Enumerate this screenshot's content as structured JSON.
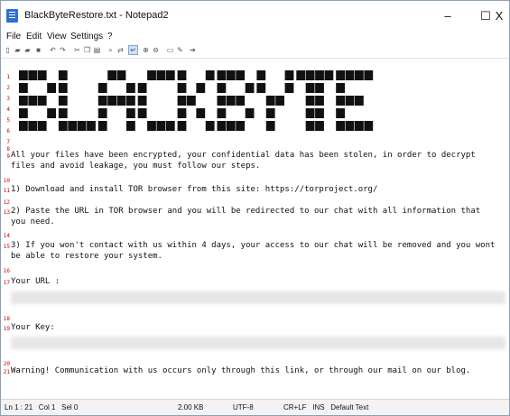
{
  "window": {
    "title": "BlackByteRestore.txt - Notepad2",
    "minimize": "–",
    "maximize": "☐",
    "close": "X"
  },
  "menu": [
    "File",
    "Edit",
    "View",
    "Settings",
    "?"
  ],
  "toolbar_icons": [
    "new-file-icon",
    "open-folder-icon",
    "open-recent-icon",
    "save-icon",
    "undo-icon",
    "redo-icon",
    "cut-icon",
    "copy-icon",
    "paste-icon",
    "find-icon",
    "replace-icon",
    "word-wrap-icon",
    "zoom-in-icon",
    "zoom-out-icon",
    "scheme-icon",
    "customize-icon",
    "exit-icon"
  ],
  "banner": {
    "text": "BLACKBYTE"
  },
  "editor": {
    "line_numbers": [
      "1",
      "2",
      "3",
      "4",
      "5",
      "6",
      "7",
      "8",
      "9",
      "10",
      "11",
      "12",
      "13",
      "14",
      "15",
      "16",
      "17",
      "18",
      "19",
      "20",
      "21"
    ],
    "lines": {
      "l9a": "All your files have been encrypted, your confidential data has been stolen, in order to decrypt",
      "l9b": "files and avoid leakage, you must follow our steps.",
      "l11": "1) Download and install TOR browser from this site: https://torproject.org/",
      "l13a": "2) Paste the URL in TOR browser and you will be redirected to our chat with all information that",
      "l13b": "you need.",
      "l15a": "3) If you won't contact with us within 4 days, your access to our chat will be removed and you wont",
      "l15b": "be able to restore your system.",
      "l17": "Your URL :",
      "l19": "Your Key:",
      "l21": "Warning! Communication with us occurs only through this link, or through our mail on our blog."
    }
  },
  "status": {
    "position": "Ln 1 : 21   Col 1   Sel 0",
    "size": "2.00 KB",
    "encoding": "UTF-8",
    "line_endings": "CR+LF   INS   Default Text"
  }
}
